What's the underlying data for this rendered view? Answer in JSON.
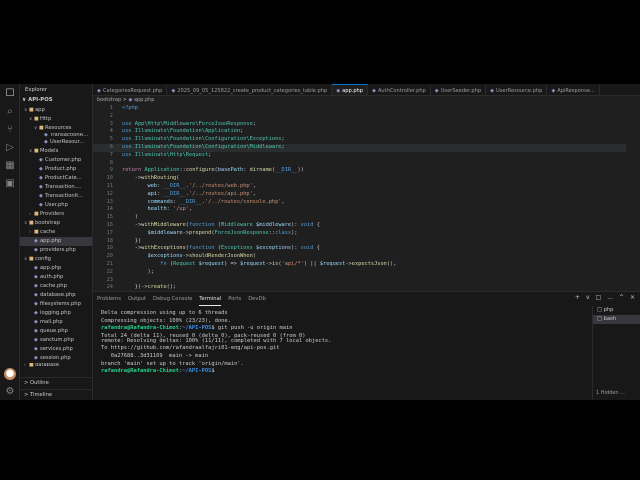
{
  "activity_bar": {
    "icons": [
      "files-icon",
      "search-icon",
      "source-control-icon",
      "run-debug-icon",
      "extensions-icon",
      "remote-explorer-icon",
      "account-icon",
      "settings-gear-icon"
    ]
  },
  "sidebar": {
    "title": "Explorer",
    "project": "API-POS",
    "tree": [
      {
        "label": "app",
        "kind": "folder",
        "chev": "v",
        "indent": 0
      },
      {
        "label": "Http",
        "kind": "folder",
        "chev": "v",
        "indent": 1
      },
      {
        "label": "Resources",
        "kind": "folder",
        "chev": "v",
        "indent": 2
      },
      {
        "label": "TransactionR...",
        "kind": "php",
        "chev": "",
        "indent": 3,
        "clip": true
      },
      {
        "label": "UserResour...",
        "kind": "php",
        "chev": "",
        "indent": 3
      },
      {
        "label": "Models",
        "kind": "folder",
        "chev": "v",
        "indent": 1
      },
      {
        "label": "Customer.php",
        "kind": "php",
        "chev": "",
        "indent": 2
      },
      {
        "label": "Product.php",
        "kind": "php",
        "chev": "",
        "indent": 2
      },
      {
        "label": "ProductCate...",
        "kind": "php",
        "chev": "",
        "indent": 2
      },
      {
        "label": "Transaction....",
        "kind": "php",
        "chev": "",
        "indent": 2
      },
      {
        "label": "TransactionIt...",
        "kind": "php",
        "chev": "",
        "indent": 2
      },
      {
        "label": "User.php",
        "kind": "php",
        "chev": "",
        "indent": 2
      },
      {
        "label": "Providers",
        "kind": "folder",
        "chev": ">",
        "indent": 1
      },
      {
        "label": "bootstrap",
        "kind": "folder",
        "chev": "v",
        "indent": 0
      },
      {
        "label": "cache",
        "kind": "folder",
        "chev": ">",
        "indent": 1
      },
      {
        "label": "app.php",
        "kind": "php",
        "chev": "",
        "indent": 1,
        "selected": true
      },
      {
        "label": "providers.php",
        "kind": "php",
        "chev": "",
        "indent": 1
      },
      {
        "label": "config",
        "kind": "folder",
        "chev": "v",
        "indent": 0
      },
      {
        "label": "app.php",
        "kind": "php",
        "chev": "",
        "indent": 1
      },
      {
        "label": "auth.php",
        "kind": "php",
        "chev": "",
        "indent": 1
      },
      {
        "label": "cache.php",
        "kind": "php",
        "chev": "",
        "indent": 1
      },
      {
        "label": "database.php",
        "kind": "php",
        "chev": "",
        "indent": 1
      },
      {
        "label": "filesystems.php",
        "kind": "php",
        "chev": "",
        "indent": 1
      },
      {
        "label": "logging.php",
        "kind": "php",
        "chev": "",
        "indent": 1
      },
      {
        "label": "mail.php",
        "kind": "php",
        "chev": "",
        "indent": 1
      },
      {
        "label": "queue.php",
        "kind": "php",
        "chev": "",
        "indent": 1
      },
      {
        "label": "sanctum.php",
        "kind": "php",
        "chev": "",
        "indent": 1
      },
      {
        "label": "services.php",
        "kind": "php",
        "chev": "",
        "indent": 1
      },
      {
        "label": "session.php",
        "kind": "php",
        "chev": "",
        "indent": 1
      },
      {
        "label": "database",
        "kind": "folder",
        "chev": ">",
        "indent": 0,
        "clip": true
      }
    ],
    "outline": "Outline",
    "timeline": "Timeline"
  },
  "tabs": [
    {
      "label": "CategoriesRequest.php",
      "active": false
    },
    {
      "label": "2025_09_05_125822_create_product_categories_table.php",
      "active": false
    },
    {
      "label": "app.php",
      "active": true
    },
    {
      "label": "AuthController.php",
      "active": false
    },
    {
      "label": "UserSeeder.php",
      "active": false
    },
    {
      "label": "UserResource.php",
      "active": false
    },
    {
      "label": "ApiResponse...",
      "active": false
    }
  ],
  "breadcrumb": {
    "folder": "bootstrap",
    "file": "app.php"
  },
  "code_lines": [
    {
      "n": "1",
      "html": "<span class='kw'>&lt;?php</span>"
    },
    {
      "n": "2",
      "html": ""
    },
    {
      "n": "3",
      "html": "<span class='kw'>use</span> <span class='ns'>App\\Http\\Middleware\\ForceJsonResponse</span>;"
    },
    {
      "n": "4",
      "html": "<span class='kw'>use</span> <span class='ns'>Illuminate\\Foundation\\Application</span>;"
    },
    {
      "n": "5",
      "html": "<span class='kw'>use</span> <span class='ns'>Illuminate\\Foundation\\Configuration\\Exceptions</span>;"
    },
    {
      "n": "6",
      "html": "<span class='kw'>use</span> <span class='ns'>Illuminate\\Foundation\\Configuration\\Middleware</span>;",
      "hl": true
    },
    {
      "n": "7",
      "html": "<span class='kw'>use</span> <span class='ns'>Illuminate\\Http\\Request</span>;"
    },
    {
      "n": "8",
      "html": ""
    },
    {
      "n": "9",
      "html": "<span class='cm'>return</span> <span class='ns'>Application</span>::<span class='fn'>configure</span>(<span class='vr'>basePath</span>: <span class='fn'>dirname</span>(<span class='kw'>__DIR__</span>))"
    },
    {
      "n": "10",
      "html": "    -&gt;<span class='fn'>withRouting</span>("
    },
    {
      "n": "11",
      "html": "        <span class='vr'>web</span>: <span class='kw'>__DIR__</span>.<span class='str'>'/../routes/web.php'</span>,"
    },
    {
      "n": "12",
      "html": "        <span class='vr'>api</span>: <span class='kw'>__DIR__</span>.<span class='str'>'/../routes/api.php'</span>,"
    },
    {
      "n": "13",
      "html": "        <span class='vr'>commands</span>: <span class='kw'>__DIR__</span>.<span class='str'>'/../routes/console.php'</span>,"
    },
    {
      "n": "14",
      "html": "        <span class='vr'>health</span>: <span class='str'>'/up'</span>,"
    },
    {
      "n": "15",
      "html": "    )"
    },
    {
      "n": "16",
      "html": "    -&gt;<span class='fn'>withMiddleware</span>(<span class='kw'>function</span> (<span class='ns'>Middleware</span> <span class='vr'>$middleware</span>): <span class='kw'>void</span> {"
    },
    {
      "n": "17",
      "html": "        <span class='vr'>$middleware</span>-&gt;<span class='fn'>prepend</span>(<span class='ns'>ForceJsonResponse</span>::<span class='kw'>class</span>);"
    },
    {
      "n": "18",
      "html": "    })"
    },
    {
      "n": "19",
      "html": "    -&gt;<span class='fn'>withExceptions</span>(<span class='kw'>function</span> (<span class='ns'>Exceptions</span> <span class='vr'>$exceptions</span>): <span class='kw'>void</span> {"
    },
    {
      "n": "20",
      "html": "        <span class='vr'>$exceptions</span>-&gt;<span class='fn'>shouldRenderJsonWhen</span>("
    },
    {
      "n": "21",
      "html": "            <span class='kw'>fn</span> (<span class='ns'>Request</span> <span class='vr'>$request</span>) =&gt; <span class='vr'>$request</span>-&gt;<span class='fn'>is</span>(<span class='str'>'api/*'</span>) || <span class='vr'>$request</span>-&gt;<span class='fn'>expectsJson</span>(),"
    },
    {
      "n": "22",
      "html": "        );"
    },
    {
      "n": "23",
      "html": ""
    },
    {
      "n": "24",
      "html": "    })-&gt;<span class='fn'>create</span>();"
    }
  ],
  "panel": {
    "tabs": [
      {
        "label": "Problems",
        "active": false
      },
      {
        "label": "Output",
        "active": false
      },
      {
        "label": "Debug Console",
        "active": false
      },
      {
        "label": "Terminal",
        "active": true
      },
      {
        "label": "Ports",
        "active": false
      },
      {
        "label": "DevDb",
        "active": false
      }
    ],
    "controls": [
      "+",
      "v",
      "□",
      "...",
      "^",
      "×"
    ],
    "terminal_lines": [
      {
        "text": "Delta compression using up to 6 threads"
      },
      {
        "text": "Compressing objects: 100% (23/23), done."
      },
      {
        "prompt": "rafandra@Rafandra-Chimot",
        "path": "~/API-POS",
        "cmd": "$ git push -u origin main"
      },
      {
        "text": "Total 24 (delta 11), reused 0 (delta 0), pack-reused 0 (from 0)",
        "overlap": true
      },
      {
        "text": "remote: Resolving deltas: 100% (11/11), completed with 7 local objects."
      },
      {
        "text": "To https://github.com/rafandraalfajri01-eng/api-pos.git"
      },
      {
        "text": "   0a27688..3d31169  main -> main"
      },
      {
        "text": "branch 'main' set up to track 'origin/main'."
      },
      {
        "prompt": "rafandra@Rafandra-Chimot",
        "path": "~/API-POS",
        "cmd": "$ "
      }
    ],
    "terminal_list": [
      {
        "label": "php",
        "selected": false
      },
      {
        "label": "bash",
        "selected": true
      }
    ],
    "terminal_footer": "1 Hidden ..."
  }
}
